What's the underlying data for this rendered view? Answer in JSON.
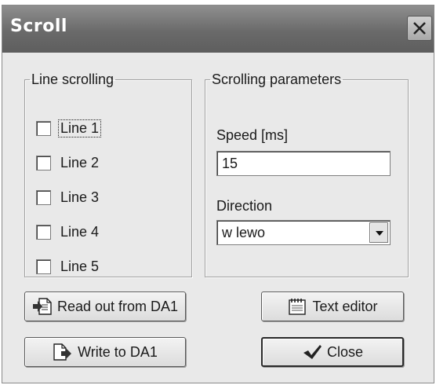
{
  "window": {
    "title": "Scroll"
  },
  "line_scrolling": {
    "legend": "Line scrolling",
    "lines": [
      {
        "label": "Line 1",
        "checked": false,
        "focused": true
      },
      {
        "label": "Line 2",
        "checked": false
      },
      {
        "label": "Line 3",
        "checked": false
      },
      {
        "label": "Line 4",
        "checked": false
      },
      {
        "label": "Line 5",
        "checked": false
      }
    ]
  },
  "parameters": {
    "legend": "Scrolling parameters",
    "speed_label": "Speed [ms]",
    "speed_value": "15",
    "direction_label": "Direction",
    "direction_value": "w lewo"
  },
  "buttons": {
    "read": "Read out from DA1",
    "write": "Write to DA1",
    "text_editor": "Text editor",
    "close": "Close"
  },
  "icons": {
    "title_close": "close-icon",
    "read": "document-import-icon",
    "write": "document-export-icon",
    "text_editor": "notepad-icon",
    "close": "checkmark-icon",
    "dropdown": "chevron-down-icon"
  }
}
